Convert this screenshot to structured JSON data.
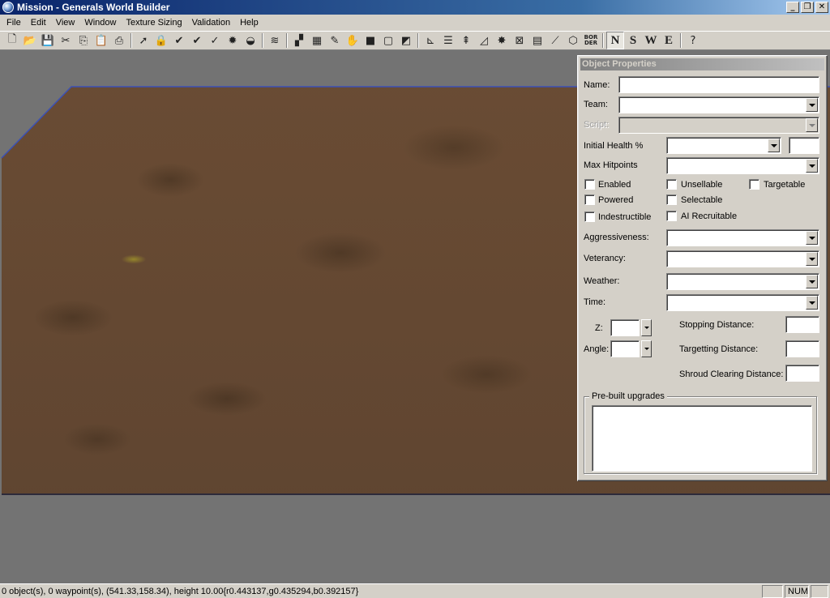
{
  "window": {
    "title": "Mission - Generals World Builder",
    "minimize": "_",
    "restore": "❐",
    "close": "✕"
  },
  "menu": [
    "File",
    "Edit",
    "View",
    "Window",
    "Texture Sizing",
    "Validation",
    "Help"
  ],
  "toolbar": {
    "border_icon_text": "BOR\nDER",
    "direction_n": "N",
    "direction_s": "S",
    "direction_w": "W",
    "direction_e": "E",
    "active_direction": "N"
  },
  "object_properties": {
    "title": "Object Properties",
    "name_label": "Name:",
    "name_value": "",
    "team_label": "Team:",
    "team_value": "",
    "script_label": "Script:",
    "script_value": "",
    "initial_health_label": "Initial Health %",
    "initial_health_value": "",
    "max_hitpoints_label": "Max Hitpoints",
    "max_hitpoints_value": "",
    "checkboxes": {
      "enabled": "Enabled",
      "unsellable": "Unsellable",
      "targetable": "Targetable",
      "powered": "Powered",
      "selectable": "Selectable",
      "indestructible": "Indestructible",
      "ai_recruitable": "AI Recruitable"
    },
    "aggressiveness_label": "Aggressiveness:",
    "veterancy_label": "Veterancy:",
    "weather_label": "Weather:",
    "time_label": "Time:",
    "z_label": "Z:",
    "angle_label": "Angle:",
    "stopping_distance_label": "Stopping Distance:",
    "targetting_distance_label": "Targetting Distance:",
    "shroud_clearing_label": "Shroud Clearing Distance:",
    "prebuilt_upgrades_label": "Pre-built upgrades"
  },
  "status": {
    "text": "0 object(s), 0 waypoint(s), (541.33,158.34), height 10.00{r0.443137,g0.435294,b0.392157}",
    "num": "NUM"
  },
  "colors": {
    "terrain": "#5e4430",
    "viewport_bg": "#737373",
    "terrain_edge": "#3c50b4"
  }
}
